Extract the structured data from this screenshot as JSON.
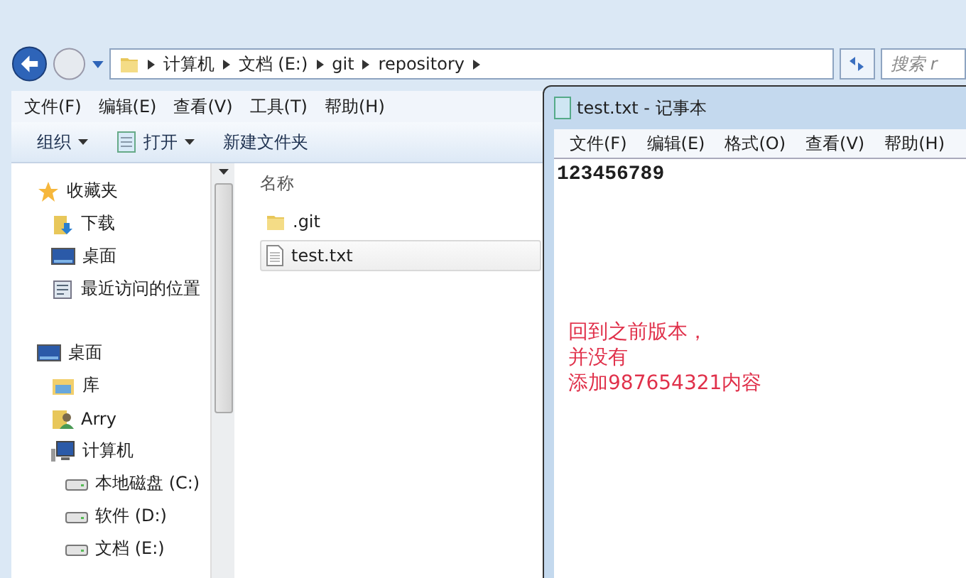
{
  "explorer": {
    "breadcrumbs": [
      "计算机",
      "文档 (E:)",
      "git",
      "repository"
    ],
    "search": {
      "placeholder": "搜索 r"
    },
    "menu": [
      "文件(F)",
      "编辑(E)",
      "查看(V)",
      "工具(T)",
      "帮助(H)"
    ],
    "toolbar": [
      {
        "label": "组织",
        "kind": "menu"
      },
      {
        "label": "打开",
        "kind": "menu-with-icon"
      },
      {
        "label": "新建文件夹",
        "kind": "button"
      }
    ],
    "sidebar": [
      {
        "label": "收藏夹",
        "kind": "star",
        "children": [
          {
            "label": "下载",
            "kind": "download"
          },
          {
            "label": "桌面",
            "kind": "desktop"
          },
          {
            "label": "最近访问的位置",
            "kind": "recent"
          }
        ]
      },
      {
        "label": "桌面",
        "kind": "desktop",
        "children": [
          {
            "label": "库",
            "kind": "library"
          },
          {
            "label": "Arry",
            "kind": "user"
          },
          {
            "label": "计算机",
            "kind": "computer",
            "children": [
              {
                "label": "本地磁盘 (C:)",
                "kind": "drive"
              },
              {
                "label": "软件 (D:)",
                "kind": "drive"
              },
              {
                "label": "文档 (E:)",
                "kind": "drive"
              }
            ]
          }
        ]
      }
    ],
    "column": "名称",
    "files": [
      {
        "name": ".git",
        "kind": "folder",
        "selected": false
      },
      {
        "name": "test.txt",
        "kind": "file",
        "selected": true
      }
    ]
  },
  "notepad": {
    "title": "test.txt - 记事本",
    "menu": [
      "文件(F)",
      "编辑(E)",
      "格式(O)",
      "查看(V)",
      "帮助(H)"
    ],
    "content": "123456789",
    "annotation": [
      "回到之前版本，",
      "并没有",
      "添加987654321内容"
    ]
  }
}
